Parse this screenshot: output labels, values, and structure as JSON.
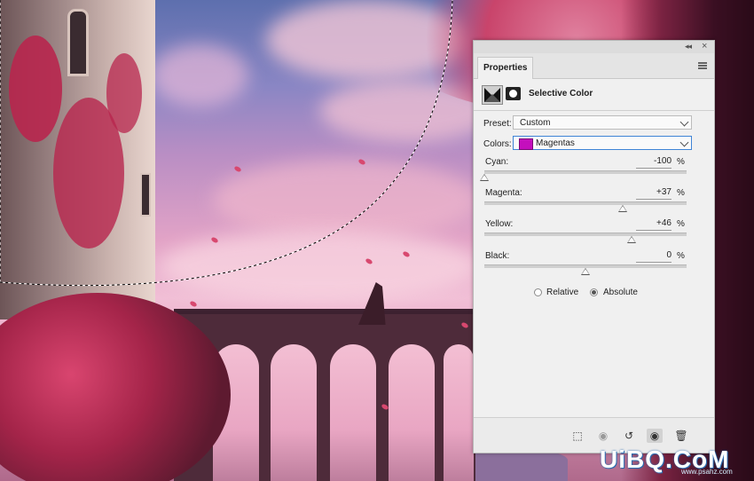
{
  "panel": {
    "tab_label": "Properties",
    "adjustment_title": "Selective Color",
    "collapse_icon": "double-chevron-icon",
    "close_icon": "close-icon"
  },
  "preset": {
    "label": "Preset:",
    "value": "Custom"
  },
  "colors": {
    "label": "Colors:",
    "value": "Magentas",
    "swatch_color": "#c40fbd"
  },
  "sliders": [
    {
      "label": "Cyan:",
      "value": "-100",
      "unit": "%",
      "level": -100
    },
    {
      "label": "Magenta:",
      "value": "+37",
      "unit": "%",
      "level": 37
    },
    {
      "label": "Yellow:",
      "value": "+46",
      "unit": "%",
      "level": 46
    },
    {
      "label": "Black:",
      "value": "0",
      "unit": "%",
      "level": 0
    }
  ],
  "method": {
    "relative_label": "Relative",
    "absolute_label": "Absolute",
    "selected": "Absolute"
  },
  "bottom_icons": [
    "clip-to-layer-icon",
    "view-previous-icon",
    "reset-icon",
    "visibility-eye-icon",
    "trash-icon"
  ],
  "watermark": {
    "text": "UiBQ.CoM",
    "sub": "www.psahz.com"
  }
}
